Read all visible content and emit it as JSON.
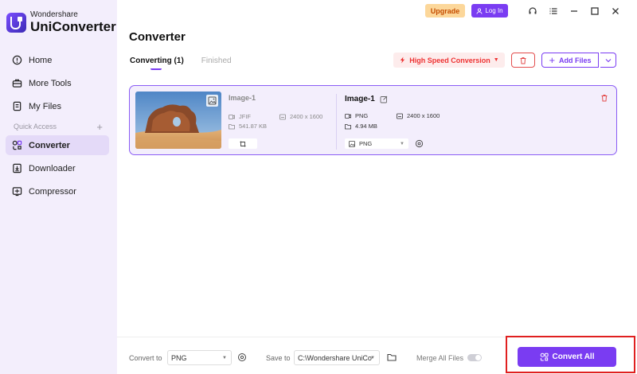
{
  "app": {
    "brand_small": "Wondershare",
    "brand_big": "UniConverter"
  },
  "sidebar": {
    "items": [
      {
        "label": "Home",
        "icon": "home-icon"
      },
      {
        "label": "More Tools",
        "icon": "toolbox-icon"
      },
      {
        "label": "My Files",
        "icon": "file-icon"
      }
    ],
    "quick_access_label": "Quick Access",
    "quick_access_plus": "+",
    "quick_items": [
      {
        "label": "Converter",
        "icon": "converter-icon",
        "active": true
      },
      {
        "label": "Downloader",
        "icon": "download-icon"
      },
      {
        "label": "Compressor",
        "icon": "compress-icon"
      }
    ]
  },
  "topbar": {
    "upgrade_label": "Upgrade",
    "login_label": "Log In"
  },
  "page": {
    "title": "Converter",
    "tabs": [
      {
        "label": "Converting (1)",
        "active": true
      },
      {
        "label": "Finished",
        "active": false
      }
    ]
  },
  "toolbar": {
    "speed_label": "High Speed Conversion",
    "add_files_label": "Add Files"
  },
  "file": {
    "source": {
      "name": "Image-1",
      "format": "JFIF",
      "resolution": "2400 x 1600",
      "size": "541.87 KB"
    },
    "output": {
      "name": "Image-1",
      "format": "PNG",
      "resolution": "2400 x 1600",
      "size": "4.94 MB",
      "selected_format": "PNG"
    }
  },
  "bottom": {
    "convert_to_label": "Convert to",
    "convert_to_value": "PNG",
    "save_to_label": "Save to",
    "save_to_value": "C:\\Wondershare UniCo",
    "merge_label": "Merge All Files",
    "convert_all_label": "Convert All"
  },
  "colors": {
    "accent": "#7a3cf2",
    "sidebar_bg": "#f3eefc",
    "danger": "#e33333",
    "upgrade_bg": "#fcd79a"
  }
}
